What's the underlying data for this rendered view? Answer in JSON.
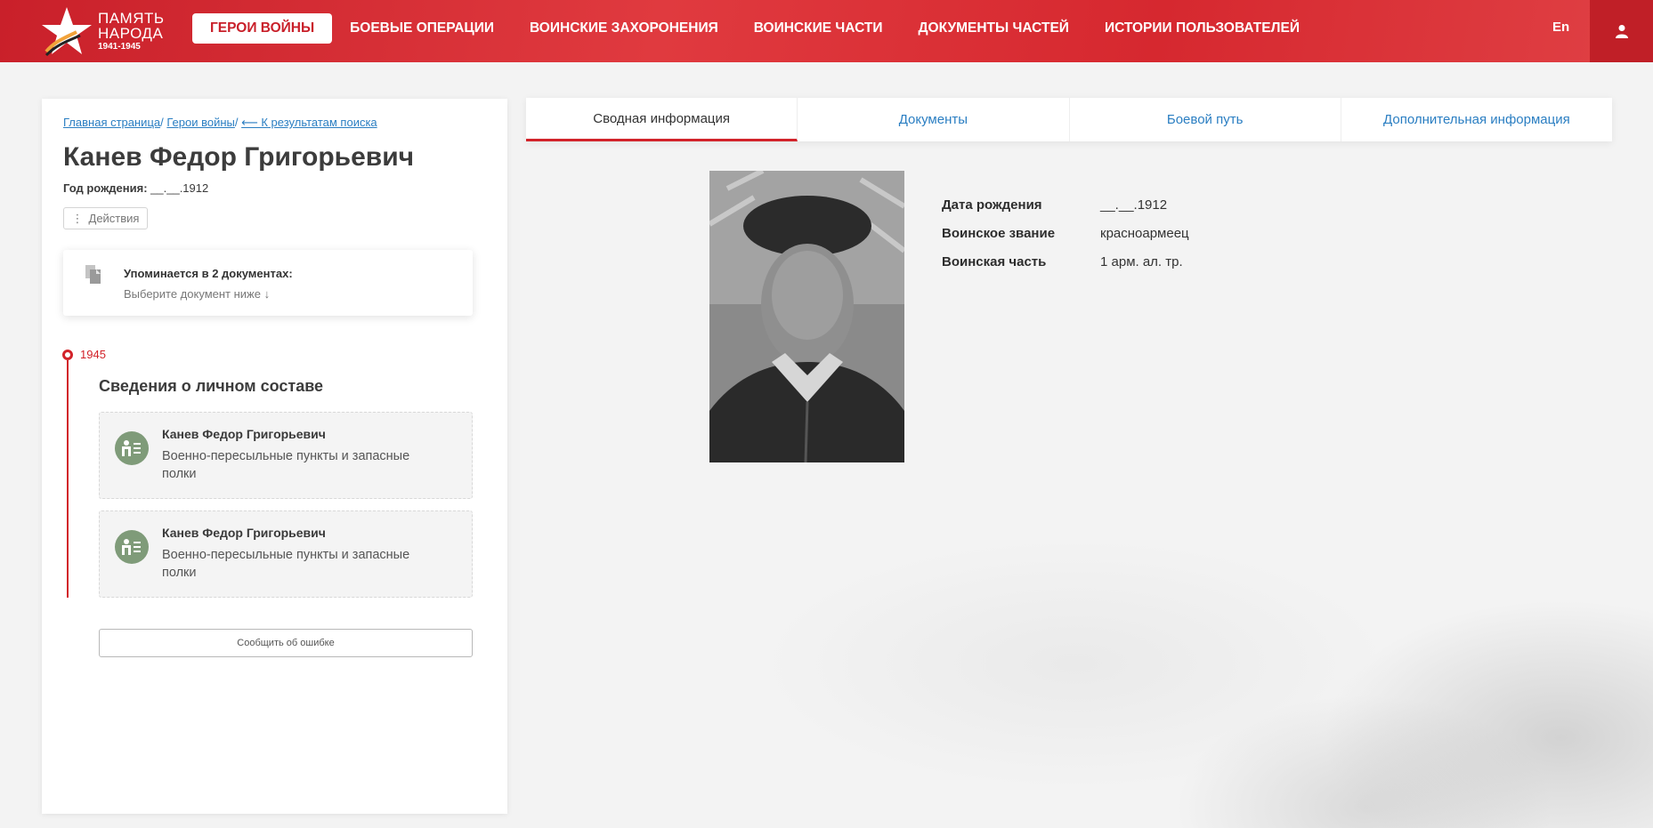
{
  "header": {
    "logo": {
      "line1": "ПАМЯТЬ",
      "line2": "НАРОДА",
      "years": "1941-1945"
    },
    "nav": [
      {
        "label": "Герои войны",
        "active": true
      },
      {
        "label": "Боевые операции",
        "active": false
      },
      {
        "label": "Воинские захоронения",
        "active": false
      },
      {
        "label": "Воинские части",
        "active": false
      },
      {
        "label": "Документы частей",
        "active": false
      },
      {
        "label": "Истории пользователей",
        "active": false
      }
    ],
    "lang": "En",
    "user_icon": "user-icon"
  },
  "breadcrumb": {
    "home": "Главная страница",
    "heroes": "Герои войны",
    "back": "⟵ К результатам поиска"
  },
  "person": {
    "name": "Канев Федор Григорьевич",
    "birth_label": "Год рождения:",
    "birth_value": "__.__.1912"
  },
  "actions_label": "Действия",
  "docs_card": {
    "title": "Упоминается в 2 документах:",
    "subtitle": "Выберите документ ниже  ↓"
  },
  "timeline": {
    "year": "1945",
    "section_title": "Сведения о личном составе",
    "records": [
      {
        "name": "Канев Федор Григорьевич",
        "desc": "Военно-пересыльные пункты и запасные полки"
      },
      {
        "name": "Канев Федор Григорьевич",
        "desc": "Военно-пересыльные пункты и запасные полки"
      }
    ]
  },
  "report_button": "Сообщить об ошибке",
  "tabs": [
    {
      "label": "Сводная информация",
      "active": true
    },
    {
      "label": "Документы",
      "active": false
    },
    {
      "label": "Боевой путь",
      "active": false
    },
    {
      "label": "Дополнительная информация",
      "active": false
    }
  ],
  "info": [
    {
      "label": "Дата рождения",
      "value": "__.__.1912"
    },
    {
      "label": "Воинское звание",
      "value": "красноармеец"
    },
    {
      "label": "Воинская часть",
      "value": "1 арм. ал. тр."
    }
  ],
  "colors": {
    "brand_red": "#d2232a",
    "link_blue": "#2a7ec2",
    "record_icon_green": "#7f9b79"
  }
}
